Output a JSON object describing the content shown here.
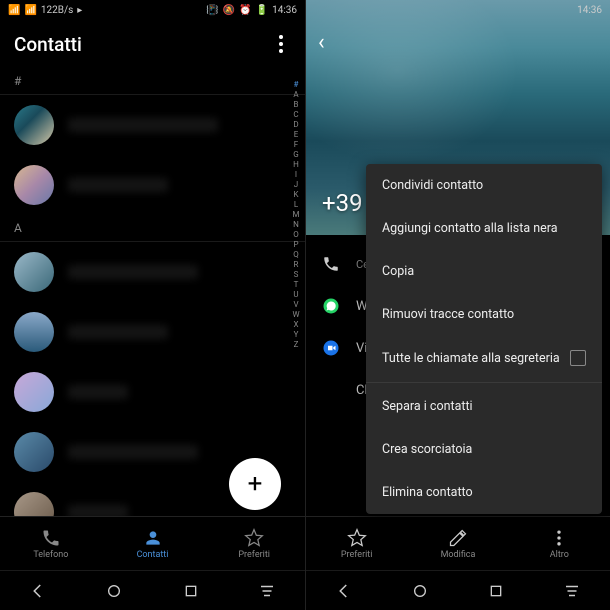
{
  "status": {
    "speed": "122B/s",
    "time": "14:36"
  },
  "left": {
    "title": "Contatti",
    "sections": {
      "hash": "#",
      "a": "A"
    },
    "alpha": [
      "#",
      "A",
      "B",
      "C",
      "D",
      "E",
      "F",
      "G",
      "H",
      "I",
      "J",
      "K",
      "L",
      "M",
      "N",
      "O",
      "P",
      "Q",
      "R",
      "S",
      "T",
      "U",
      "V",
      "W",
      "X",
      "Y",
      "Z"
    ],
    "fab": "+",
    "nav": {
      "phone": "Telefono",
      "contacts": "Contatti",
      "favorites": "Preferiti"
    }
  },
  "right": {
    "phone_prefix": "+39",
    "details": {
      "cell": "Cell",
      "whatsapp": "Wh",
      "video": "Vid",
      "chat": "Chi"
    },
    "menu": {
      "share": "Condividi contatto",
      "blacklist": "Aggiungi contatto alla lista nera",
      "copy": "Copia",
      "remove_traces": "Rimuovi tracce contatto",
      "all_calls": "Tutte le chiamate alla segreteria",
      "separate": "Separa i contatti",
      "shortcut": "Crea scorciatoia",
      "delete": "Elimina contatto"
    },
    "nav": {
      "favorites": "Preferiti",
      "edit": "Modifica",
      "more": "Altro"
    }
  }
}
